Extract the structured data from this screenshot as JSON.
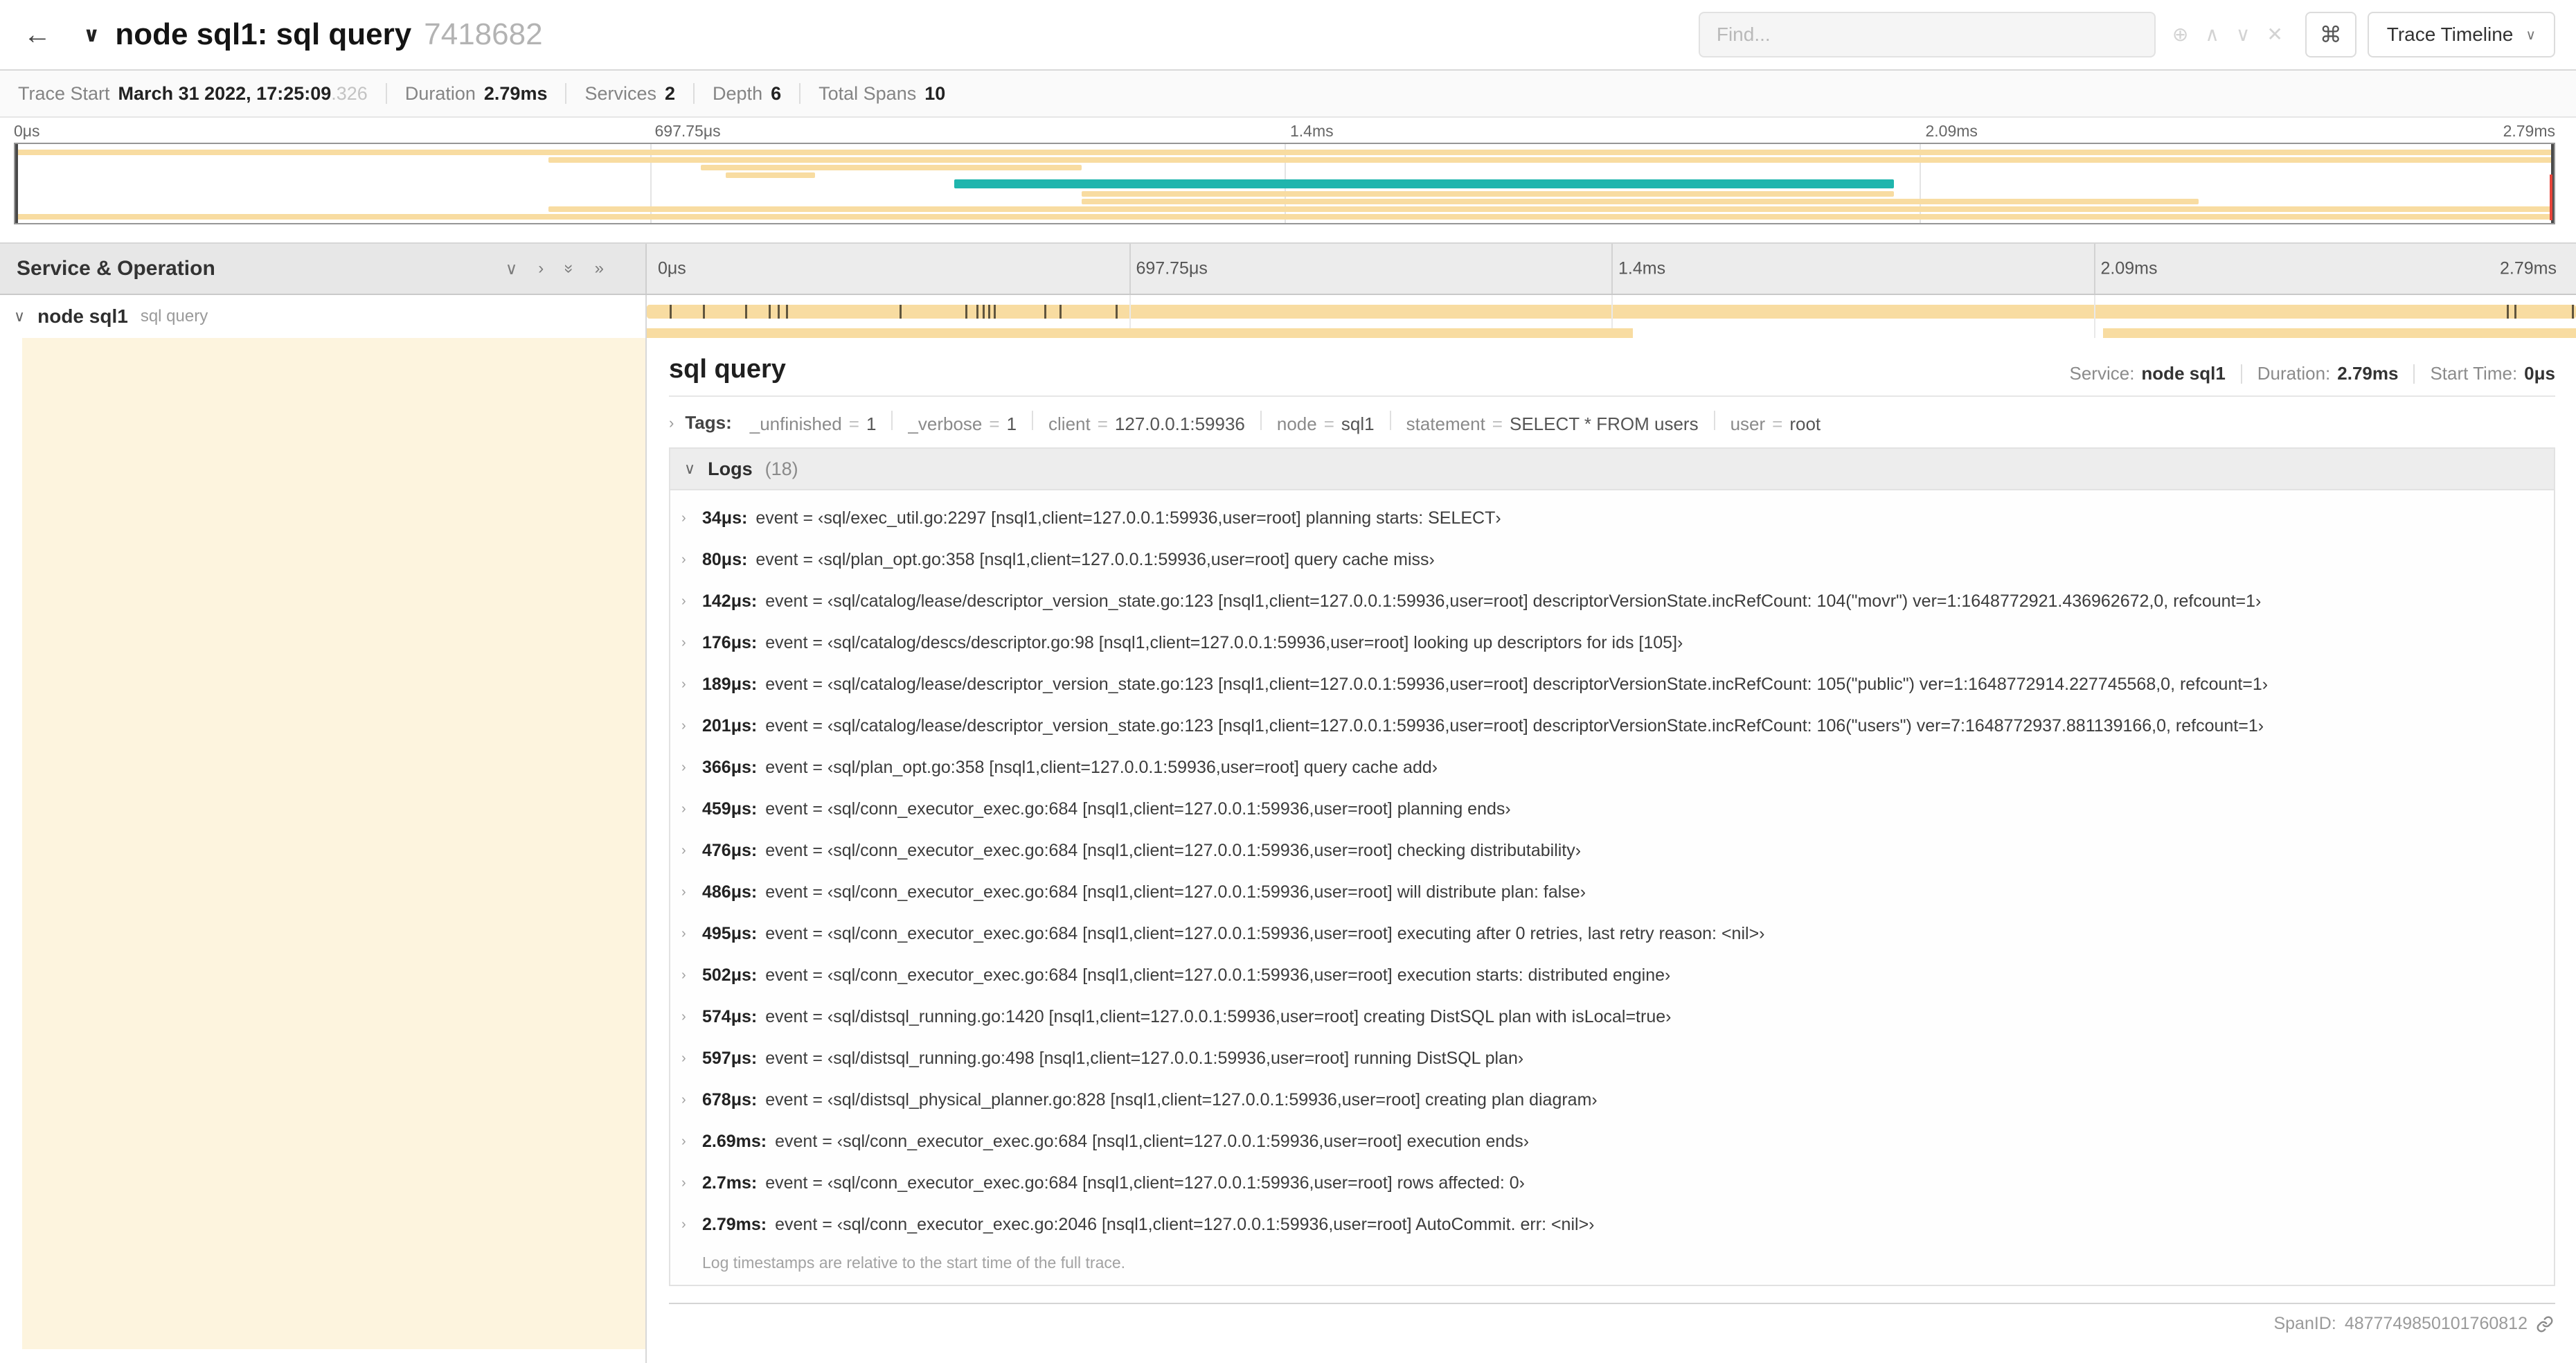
{
  "icons": {
    "back": "←",
    "chevron_down": "∨",
    "chevron_right": "›",
    "double_chevron": "»",
    "find_zoom": "⊕",
    "find_prev": "∧",
    "find_next": "∨",
    "find_clear": "✕",
    "command": "⌘"
  },
  "topbar": {
    "title": "node sql1: sql query",
    "trace_id": "7418682",
    "find_placeholder": "Find...",
    "view_button_label": "Trace Timeline"
  },
  "summary": {
    "items": [
      {
        "label": "Trace Start",
        "value": "March 31 2022, 17:25:09",
        "suffix": ".326"
      },
      {
        "label": "Duration",
        "value": "2.79ms"
      },
      {
        "label": "Services",
        "value": "2"
      },
      {
        "label": "Depth",
        "value": "6"
      },
      {
        "label": "Total Spans",
        "value": "10"
      }
    ]
  },
  "timeline": {
    "ticks": [
      "0μs",
      "697.75μs",
      "1.4ms",
      "2.09ms",
      "2.79ms"
    ],
    "left_header": "Service & Operation",
    "row": {
      "service": "node sql1",
      "operation": "sql query",
      "log_tick_percents": [
        1.2,
        2.9,
        5.1,
        6.3,
        6.8,
        7.2,
        13.1,
        16.5,
        17.1,
        17.4,
        17.7,
        18,
        20.6,
        21.4,
        24.3,
        96.4,
        96.8,
        99.8
      ],
      "sub_segments": [
        {
          "start": 0,
          "end": 51.1
        },
        {
          "start": 75.5,
          "end": 100
        }
      ]
    }
  },
  "minimap": {
    "bars": [
      {
        "y": 4,
        "h": 4,
        "start": 0,
        "end": 100,
        "color": "tan"
      },
      {
        "y": 9.5,
        "h": 4,
        "start": 21,
        "end": 100,
        "color": "tan"
      },
      {
        "y": 15,
        "h": 4,
        "start": 27,
        "end": 42,
        "color": "tan"
      },
      {
        "y": 20.5,
        "h": 4,
        "start": 28,
        "end": 31.5,
        "color": "tan"
      },
      {
        "y": 25.5,
        "h": 6.5,
        "start": 37,
        "end": 74,
        "color": "teal"
      },
      {
        "y": 34,
        "h": 4,
        "start": 42,
        "end": 74,
        "color": "tan"
      },
      {
        "y": 39.5,
        "h": 4,
        "start": 42,
        "end": 86,
        "color": "tan"
      },
      {
        "y": 45,
        "h": 4,
        "start": 21,
        "end": 100,
        "color": "tan"
      },
      {
        "y": 50.5,
        "h": 4,
        "start": 0,
        "end": 100,
        "color": "tan"
      }
    ]
  },
  "detail": {
    "title": "sql query",
    "meta": [
      {
        "label": "Service:",
        "value": "node sql1"
      },
      {
        "label": "Duration:",
        "value": "2.79ms"
      },
      {
        "label": "Start Time:",
        "value": "0μs"
      }
    ],
    "tags_label": "Tags:",
    "tags": [
      {
        "k": "_unfinished",
        "v": "1"
      },
      {
        "k": "_verbose",
        "v": "1"
      },
      {
        "k": "client",
        "v": "127.0.0.1:59936"
      },
      {
        "k": "node",
        "v": "sql1"
      },
      {
        "k": "statement",
        "v": "SELECT * FROM users"
      },
      {
        "k": "user",
        "v": "root"
      }
    ],
    "logs_title": "Logs",
    "logs_count": "(18)",
    "logs": [
      {
        "t": "34μs:",
        "msg": "event = ‹sql/exec_util.go:2297 [nsql1,client=127.0.0.1:59936,user=root] planning starts: SELECT›"
      },
      {
        "t": "80μs:",
        "msg": "event = ‹sql/plan_opt.go:358 [nsql1,client=127.0.0.1:59936,user=root] query cache miss›"
      },
      {
        "t": "142μs:",
        "msg": "event = ‹sql/catalog/lease/descriptor_version_state.go:123 [nsql1,client=127.0.0.1:59936,user=root] descriptorVersionState.incRefCount: 104(\"movr\") ver=1:1648772921.436962672,0, refcount=1›"
      },
      {
        "t": "176μs:",
        "msg": "event = ‹sql/catalog/descs/descriptor.go:98 [nsql1,client=127.0.0.1:59936,user=root] looking up descriptors for ids [105]›"
      },
      {
        "t": "189μs:",
        "msg": "event = ‹sql/catalog/lease/descriptor_version_state.go:123 [nsql1,client=127.0.0.1:59936,user=root] descriptorVersionState.incRefCount: 105(\"public\") ver=1:1648772914.227745568,0, refcount=1›"
      },
      {
        "t": "201μs:",
        "msg": "event = ‹sql/catalog/lease/descriptor_version_state.go:123 [nsql1,client=127.0.0.1:59936,user=root] descriptorVersionState.incRefCount: 106(\"users\") ver=7:1648772937.881139166,0, refcount=1›"
      },
      {
        "t": "366μs:",
        "msg": "event = ‹sql/plan_opt.go:358 [nsql1,client=127.0.0.1:59936,user=root] query cache add›"
      },
      {
        "t": "459μs:",
        "msg": "event = ‹sql/conn_executor_exec.go:684 [nsql1,client=127.0.0.1:59936,user=root] planning ends›"
      },
      {
        "t": "476μs:",
        "msg": "event = ‹sql/conn_executor_exec.go:684 [nsql1,client=127.0.0.1:59936,user=root] checking distributability›"
      },
      {
        "t": "486μs:",
        "msg": "event = ‹sql/conn_executor_exec.go:684 [nsql1,client=127.0.0.1:59936,user=root] will distribute plan: false›"
      },
      {
        "t": "495μs:",
        "msg": "event = ‹sql/conn_executor_exec.go:684 [nsql1,client=127.0.0.1:59936,user=root] executing after 0 retries, last retry reason: <nil>›"
      },
      {
        "t": "502μs:",
        "msg": "event = ‹sql/conn_executor_exec.go:684 [nsql1,client=127.0.0.1:59936,user=root] execution starts: distributed engine›"
      },
      {
        "t": "574μs:",
        "msg": "event = ‹sql/distsql_running.go:1420 [nsql1,client=127.0.0.1:59936,user=root] creating DistSQL plan with isLocal=true›"
      },
      {
        "t": "597μs:",
        "msg": "event = ‹sql/distsql_running.go:498 [nsql1,client=127.0.0.1:59936,user=root] running DistSQL plan›"
      },
      {
        "t": "678μs:",
        "msg": "event = ‹sql/distsql_physical_planner.go:828 [nsql1,client=127.0.0.1:59936,user=root] creating plan diagram›"
      },
      {
        "t": "2.69ms:",
        "msg": "event = ‹sql/conn_executor_exec.go:684 [nsql1,client=127.0.0.1:59936,user=root] execution ends›"
      },
      {
        "t": "2.7ms:",
        "msg": "event = ‹sql/conn_executor_exec.go:684 [nsql1,client=127.0.0.1:59936,user=root] rows affected: 0›"
      },
      {
        "t": "2.79ms:",
        "msg": "event = ‹sql/conn_executor_exec.go:2046 [nsql1,client=127.0.0.1:59936,user=root] AutoCommit. err: <nil>›"
      }
    ],
    "footer_note": "Log timestamps are relative to the start time of the full trace.",
    "span_id_label": "SpanID:",
    "span_id": "4877749850101760812"
  },
  "colors": {
    "span_tan": "#f8dca1",
    "span_teal": "#1fb5ad",
    "detail_cream": "#fdf4de",
    "red_marker": "#e8443a",
    "log_tick": "#3a3326"
  }
}
